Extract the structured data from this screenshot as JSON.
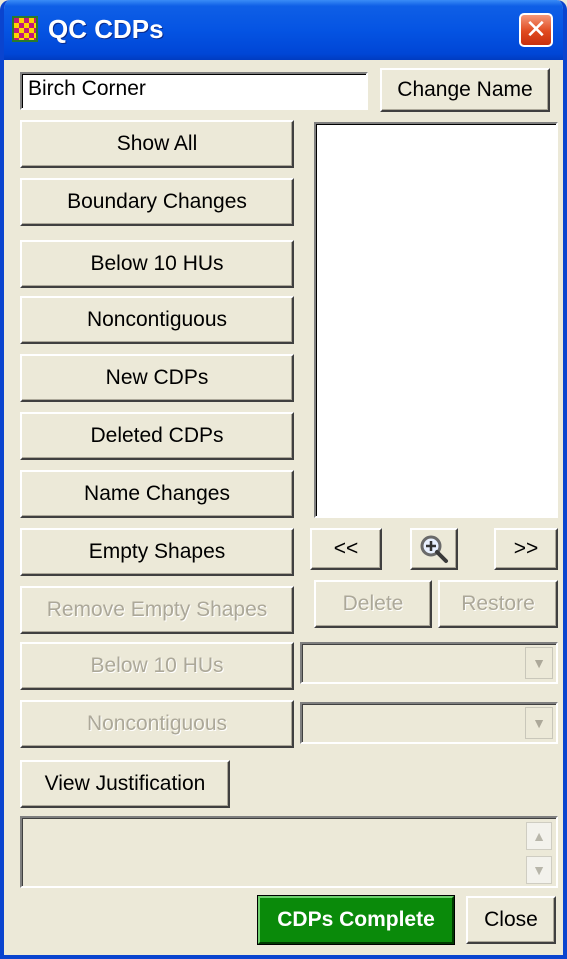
{
  "window": {
    "title": "QC CDPs",
    "close_glyph": "✕"
  },
  "name_field": {
    "value": "Birch Corner"
  },
  "buttons": {
    "change_name": "Change Name",
    "show_all": "Show All",
    "boundary_changes": "Boundary Changes",
    "below_10_hus": "Below 10 HUs",
    "noncontiguous": "Noncontiguous",
    "new_cdps": "New CDPs",
    "deleted_cdps": "Deleted CDPs",
    "name_changes": "Name Changes",
    "empty_shapes": "Empty Shapes",
    "remove_empty_shapes": "Remove Empty Shapes",
    "below_10_hus_disabled": "Below 10 HUs",
    "noncontiguous_disabled": "Noncontiguous",
    "view_justification": "View Justification",
    "prev": "<<",
    "next": ">>",
    "delete": "Delete",
    "restore": "Restore",
    "cdps_complete": "CDPs Complete",
    "close": "Close"
  },
  "icons": {
    "app": "app-icon",
    "zoom": "zoom-in-icon"
  },
  "colors": {
    "title_bar": "#0554e3",
    "complete_button": "#0a8a0a",
    "close_x": "#e04a1f"
  }
}
